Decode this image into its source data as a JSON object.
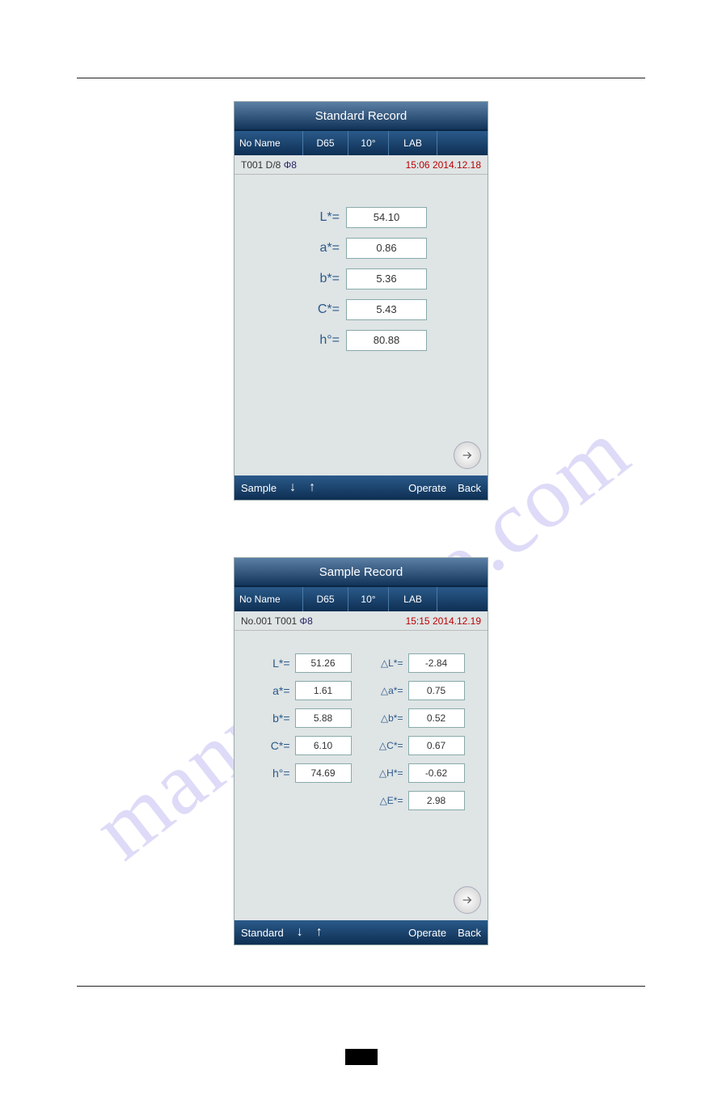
{
  "watermark": "manualshive.com",
  "screen1": {
    "title": "Standard Record",
    "seg": {
      "name": "No Name",
      "d65": "D65",
      "deg": "10°",
      "lab": "LAB"
    },
    "meta": {
      "left": "T001  D/8  ",
      "phi": "Φ8",
      "right": "15:06  2014.12.18"
    },
    "rows": [
      {
        "label": "L*=",
        "value": "54.10"
      },
      {
        "label": "a*=",
        "value": "0.86"
      },
      {
        "label": "b*=",
        "value": "5.36"
      },
      {
        "label": "C*=",
        "value": "5.43"
      },
      {
        "label": "h°=",
        "value": "80.88"
      }
    ],
    "foot": {
      "left": "Sample",
      "op": "Operate",
      "back": "Back"
    }
  },
  "screen2": {
    "title": "Sample Record",
    "seg": {
      "name": "No Name",
      "d65": "D65",
      "deg": "10°",
      "lab": "LAB"
    },
    "meta": {
      "left": "No.001  T001  ",
      "phi": "Φ8",
      "right": "15:15  2014.12.19"
    },
    "rows": [
      {
        "label": "L*=",
        "value": "51.26",
        "dlabel": "△L*=",
        "dvalue": "-2.84"
      },
      {
        "label": "a*=",
        "value": "1.61",
        "dlabel": "△a*=",
        "dvalue": "0.75"
      },
      {
        "label": "b*=",
        "value": "5.88",
        "dlabel": "△b*=",
        "dvalue": "0.52"
      },
      {
        "label": "C*=",
        "value": "6.10",
        "dlabel": "△C*=",
        "dvalue": "0.67"
      },
      {
        "label": "h°=",
        "value": "74.69",
        "dlabel": "△H*=",
        "dvalue": "-0.62"
      },
      {
        "label": "",
        "value": "",
        "dlabel": "△E*=",
        "dvalue": "2.98"
      }
    ],
    "foot": {
      "left": "Standard",
      "op": "Operate",
      "back": "Back"
    }
  }
}
